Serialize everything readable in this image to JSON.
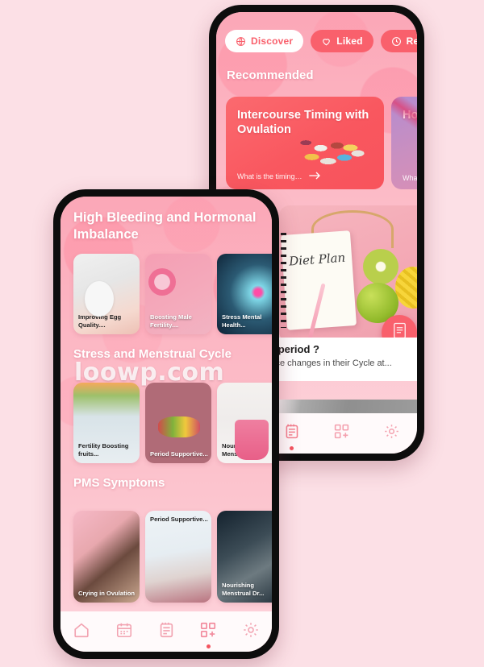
{
  "app": {
    "background_color": "#fce0e6",
    "accent_color": "#f9606c"
  },
  "watermark": {
    "text": "loowp.com"
  },
  "back_phone": {
    "tabs": [
      {
        "label": "Discover",
        "icon": "globe-icon",
        "active": true
      },
      {
        "label": "Liked",
        "icon": "heart-icon",
        "active": false
      },
      {
        "label": "Recent",
        "icon": "clock-icon",
        "active": false
      }
    ],
    "section_title": "Recommended",
    "recommended_cards": [
      {
        "title": "Intercourse Timing with Ovulation",
        "subtitle": "What is the timing of intercourses in...",
        "arrow": "arrow-right-icon",
        "color": "#f9575f"
      },
      {
        "title": "Hormonal Ovulation",
        "subtitle": "What hormonal...",
        "color": "#c98fc0"
      }
    ],
    "diet_card": {
      "notebook_text": "Diet Plan",
      "fab_icon": "document-icon"
    },
    "info_card": {
      "title": "affect my period ?",
      "body": "en experience changes in their Cycle at..."
    },
    "nav_items": [
      {
        "icon": "calendar-icon",
        "active": false
      },
      {
        "icon": "notepad-icon",
        "active": true
      },
      {
        "icon": "grid-plus-icon",
        "active": false
      },
      {
        "icon": "gear-icon",
        "active": false
      }
    ]
  },
  "front_phone": {
    "header_title": "High Bleeding and Hormonal Imbalance",
    "sections": [
      {
        "title": "",
        "cards": [
          {
            "label": "Improving Egg Quality....",
            "label_position": "bottom",
            "label_color": "dark",
            "image": "hand-on-white-egg"
          },
          {
            "label": "Boosting Male Fertility....",
            "label_position": "bottom",
            "label_color": "light",
            "image": "pink-sperm-graphic"
          },
          {
            "label": "Stress Mental Health...",
            "label_position": "bottom",
            "label_color": "light",
            "image": "glowing-brain"
          }
        ]
      },
      {
        "title": "Stress and Menstrual Cycle",
        "cards": [
          {
            "label": "Fertility Boosting fruits...",
            "label_position": "bottom",
            "label_color": "dark",
            "image": "fruits-on-ice"
          },
          {
            "label": "Period Supportive...",
            "label_position": "bottom",
            "label_color": "light",
            "image": "vegetables-on-mauve"
          },
          {
            "label": "Nourishing Menstrual Dr...",
            "label_position": "bottom",
            "label_color": "dark",
            "image": "pink-smoothie"
          }
        ]
      },
      {
        "title": "PMS Symptoms",
        "cards": [
          {
            "label": "Crying in Ovulation",
            "label_position": "bottom",
            "label_color": "light",
            "image": "woman-crying"
          },
          {
            "label": "Period Supportive...",
            "label_position": "top",
            "label_color": "dark",
            "image": "pregnant-woman-sitting"
          },
          {
            "label": "Nourishing Menstrual Dr...",
            "label_position": "bottom",
            "label_color": "light",
            "image": "woman-headache"
          }
        ]
      }
    ],
    "nav_items": [
      {
        "icon": "home-icon",
        "active": false
      },
      {
        "icon": "calendar-icon",
        "active": false
      },
      {
        "icon": "notepad-icon",
        "active": false
      },
      {
        "icon": "grid-plus-icon",
        "active": true
      },
      {
        "icon": "gear-icon",
        "active": false
      }
    ]
  }
}
